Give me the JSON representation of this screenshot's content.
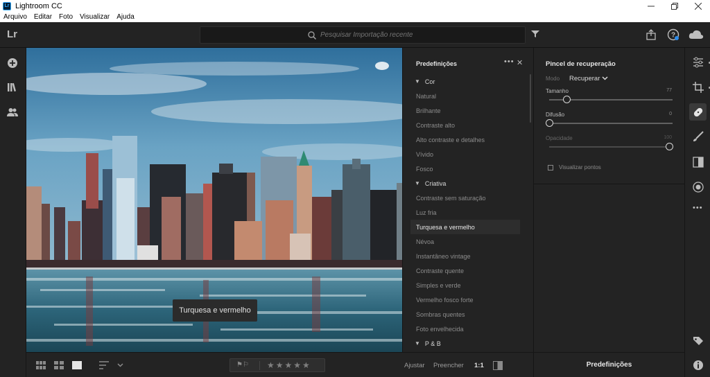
{
  "window": {
    "title": "Lightroom CC",
    "app_icon_text": "Lr",
    "controls": [
      "minimize",
      "restore",
      "close"
    ]
  },
  "menu": [
    "Arquivo",
    "Editar",
    "Foto",
    "Visualizar",
    "Ajuda"
  ],
  "appbar": {
    "logo": "Lr",
    "search_placeholder": "Pesquisar Importação recente"
  },
  "presets_panel": {
    "title": "Predefinições",
    "items": [
      {
        "label": "Cor",
        "group": true
      },
      {
        "label": "Natural"
      },
      {
        "label": "Brilhante"
      },
      {
        "label": "Contraste alto"
      },
      {
        "label": "Alto contraste e detalhes"
      },
      {
        "label": "Vívido"
      },
      {
        "label": "Fosco"
      },
      {
        "label": "Criativa",
        "group": true
      },
      {
        "label": "Contraste sem saturação"
      },
      {
        "label": "Luz fria"
      },
      {
        "label": "Turquesa e vermelho",
        "selected": true
      },
      {
        "label": "Névoa"
      },
      {
        "label": "Instantâneo vintage"
      },
      {
        "label": "Contraste quente"
      },
      {
        "label": "Simples e verde"
      },
      {
        "label": "Vermelho fosco forte"
      },
      {
        "label": "Sombras quentes"
      },
      {
        "label": "Foto envelhecida"
      },
      {
        "label": "P & B",
        "group": true
      }
    ]
  },
  "photo": {
    "toast": "Turquesa e vermelho"
  },
  "healing_panel": {
    "title": "Pincel de recuperação",
    "mode_label": "Modo",
    "mode_value": "Recuperar",
    "sliders": [
      {
        "label": "Tamanho",
        "value": "77",
        "level": 0.14,
        "enabled": true
      },
      {
        "label": "Difusão",
        "value": "0",
        "level": 0.0,
        "enabled": true
      },
      {
        "label": "Opacidade",
        "value": "100",
        "level": 1.0,
        "enabled": false
      }
    ],
    "checkbox_label": "Visualizar pontos"
  },
  "bottombar": {
    "zoom_fit": "Ajustar",
    "zoom_fill": "Preencher",
    "zoom_one": "1:1",
    "stars": "★★★★★",
    "flags": "⚑⚐"
  },
  "presets_button": "Predefinições",
  "colors": {
    "panel_bg": "#232323",
    "selection_bg": "#2d2d2d",
    "accent_water": "#3d7f95"
  }
}
